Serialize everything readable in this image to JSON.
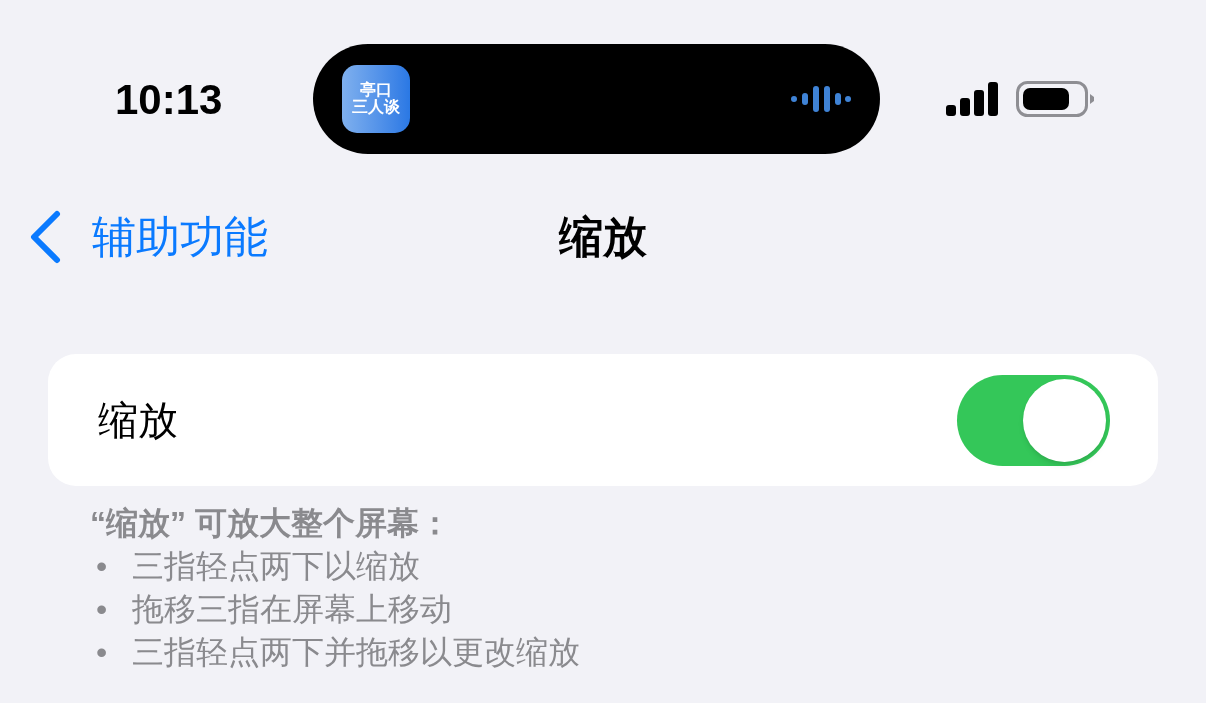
{
  "status_bar": {
    "time": "10:13",
    "dynamic_island": {
      "app_icon_lines": [
        "亭口",
        "三人谈"
      ]
    }
  },
  "nav_bar": {
    "back_label": "辅助功能",
    "title": "缩放"
  },
  "settings": [
    {
      "kind": "toggle",
      "label": "缩放",
      "on": true
    }
  ],
  "footer": {
    "title": "“缩放” 可放大整个屏幕：",
    "items": [
      {
        "bullet": "•",
        "text": "三指轻点两下以缩放"
      },
      {
        "bullet": "•",
        "text": "拖移三指在屏幕上移动"
      },
      {
        "bullet": "•",
        "text": "三指轻点两下并拖移以更改缩放"
      }
    ]
  }
}
